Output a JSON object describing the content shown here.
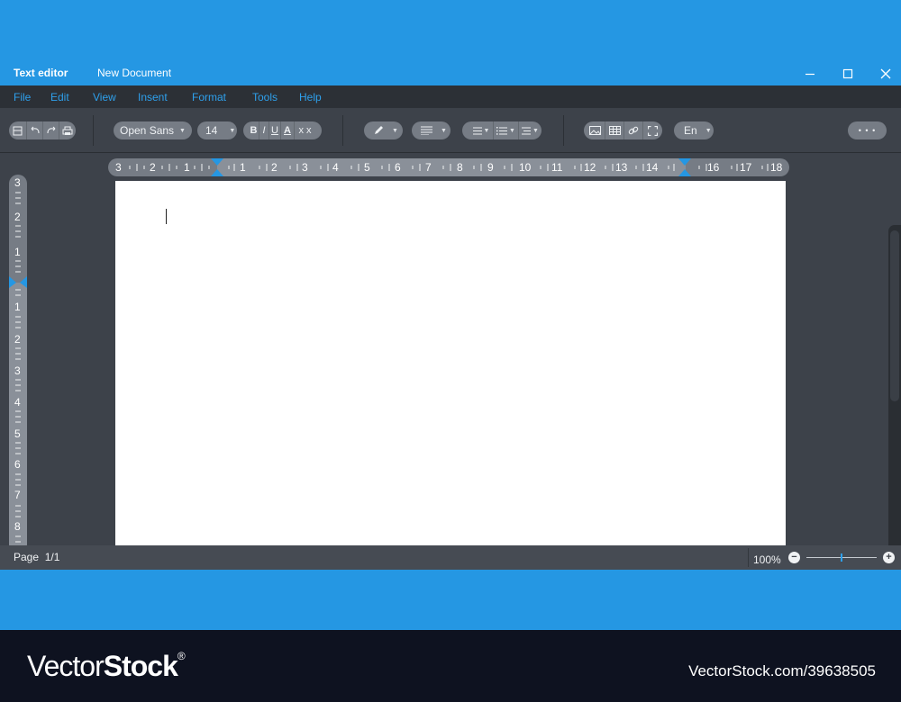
{
  "window": {
    "app_title": "Text editor",
    "doc_title": "New Document",
    "minimize_icon": "minimize-icon",
    "maximize_icon": "maximize-icon",
    "close_icon": "close-icon"
  },
  "menu": [
    "File",
    "Edit",
    "View",
    "Insent",
    "Format",
    "Tools",
    "Help"
  ],
  "toolbar": {
    "font_family": "Open Sans",
    "font_size": "14",
    "bold": "B",
    "italic": "I",
    "underline": "U",
    "text_style": "A",
    "clear_format": "x x",
    "language": "En",
    "more": "• • •"
  },
  "ruler": {
    "horizontal": [
      "3",
      "2",
      "1",
      "1",
      "2",
      "3",
      "4",
      "5",
      "6",
      "7",
      "8",
      "9",
      "10",
      "11",
      "12",
      "13",
      "14",
      "16",
      "17",
      "18"
    ],
    "vertical": [
      "3",
      "2",
      "1",
      "1",
      "2",
      "3",
      "4",
      "5",
      "6",
      "7",
      "8"
    ]
  },
  "status": {
    "page_label": "Page",
    "page_value": "1/1",
    "zoom": "100%",
    "zoom_out": "−",
    "zoom_in": "+",
    "zoom_level": 0.5
  },
  "footer": {
    "brand_regular": "Vector",
    "brand_bold": "Stock",
    "brand_mark": "®",
    "asset_id": "VectorStock.com/39638505"
  },
  "colors": {
    "accent": "#2597e3",
    "menu_text": "#2ea0ec",
    "toolbar_bg": "#3d424a",
    "menubar_bg": "#2c3036",
    "footer_bg": "#0e1220"
  }
}
